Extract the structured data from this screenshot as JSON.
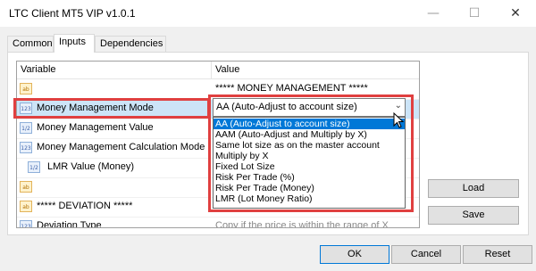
{
  "window": {
    "title": "LTC Client MT5 VIP v1.0.1",
    "minimize_glyph": "—",
    "maximize_glyph": "☐",
    "close_glyph": "✕"
  },
  "tabs": [
    {
      "label": "Common",
      "active": false
    },
    {
      "label": "Inputs",
      "active": true
    },
    {
      "label": "Dependencies",
      "active": false
    }
  ],
  "table": {
    "headers": {
      "variable": "Variable",
      "value": "Value"
    },
    "rows": [
      {
        "icon": "ab",
        "variable": "",
        "value": "***** MONEY MANAGEMENT *****"
      },
      {
        "icon": "123",
        "variable": "Money Management Mode",
        "value": ""
      },
      {
        "icon": "1/2",
        "variable": "Money Management Value",
        "value": ""
      },
      {
        "icon": "123",
        "variable": "Money Management Calculation Mode",
        "value": ""
      },
      {
        "icon": "1/2",
        "variable": "LMR Value (Money)",
        "value": ""
      },
      {
        "icon": "ab",
        "variable": "",
        "value": ""
      },
      {
        "icon": "ab",
        "variable": "***** DEVIATION *****",
        "value": ""
      },
      {
        "icon": "123",
        "variable": "Deviation Type",
        "value": "Copy if the price is within the range of X"
      },
      {
        "icon": "1/2",
        "variable": "",
        "value": ""
      }
    ]
  },
  "combo": {
    "selected": "AA (Auto-Adjust to account size)",
    "arrow": "⌄",
    "options": [
      "AA (Auto-Adjust to account size)",
      "AAM (Auto-Adjust and Multiply by X)",
      "Same lot size as on the master account",
      "Multiply by X",
      "Fixed Lot Size",
      "Risk Per Trade (%)",
      "Risk Per Trade (Money)",
      "LMR (Lot Money Ratio)"
    ]
  },
  "side_buttons": {
    "load": "Load",
    "save": "Save"
  },
  "bottom_buttons": {
    "ok": "OK",
    "cancel": "Cancel",
    "reset": "Reset"
  },
  "colors": {
    "highlight_box": "#e04040",
    "selection": "#0078d7"
  }
}
